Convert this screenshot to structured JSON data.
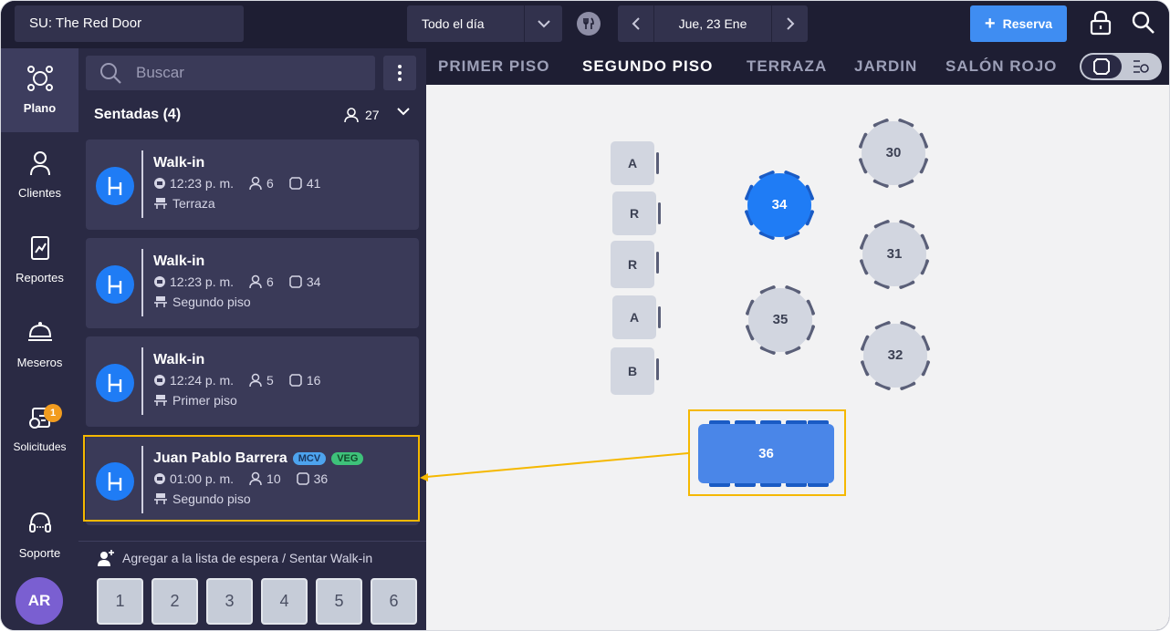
{
  "header": {
    "venue": "SU: The Red Door",
    "shift_label": "Todo el día",
    "date_label": "Jue, 23 Ene",
    "reserve_button": "Reserva"
  },
  "nav": {
    "items": [
      {
        "label": "Plano",
        "icon": "floor-plan-icon",
        "active": true
      },
      {
        "label": "Clientes",
        "icon": "person-icon"
      },
      {
        "label": "Reportes",
        "icon": "report-icon"
      },
      {
        "label": "Meseros",
        "icon": "waiter-icon"
      },
      {
        "label": "Solicitudes",
        "icon": "requests-icon"
      },
      {
        "label": "Soporte",
        "icon": "headset-icon"
      }
    ],
    "requests_badge": "1",
    "avatar_initials": "AR"
  },
  "list": {
    "search_placeholder": "Buscar",
    "section_title": "Sentadas (4)",
    "section_count": "27",
    "cards": [
      {
        "name": "Walk-in",
        "time": "12:23 p. m.",
        "guests": "6",
        "table": "41",
        "zone": "Terraza",
        "tags": []
      },
      {
        "name": "Walk-in",
        "time": "12:23 p. m.",
        "guests": "6",
        "table": "34",
        "zone": "Segundo piso",
        "tags": []
      },
      {
        "name": "Walk-in",
        "time": "12:24 p. m.",
        "guests": "5",
        "table": "16",
        "zone": "Primer piso",
        "tags": []
      },
      {
        "name": "Juan Pablo Barrera",
        "time": "01:00 p. m.",
        "guests": "10",
        "table": "36",
        "zone": "Segundo piso",
        "tags": [
          "MCV",
          "VEG"
        ]
      }
    ],
    "footer_title": "Agregar a la lista de espera / Sentar Walk-in",
    "party_sizes": [
      "1",
      "2",
      "3",
      "4",
      "5",
      "6"
    ]
  },
  "floor": {
    "tabs": [
      "PRIMER PISO",
      "SEGUNDO PISO",
      "TERRAZA",
      "JARDIN",
      "SALÓN ROJO"
    ],
    "active_tab": "SEGUNDO PISO",
    "square_tables": [
      "A",
      "R",
      "R",
      "A",
      "B"
    ],
    "round_tables": [
      "30",
      "34",
      "31",
      "35",
      "32"
    ],
    "selected_table": "34",
    "rect_table": "36",
    "colors": {
      "selected": "#1f7cf5",
      "occupied": "#4a86e8",
      "free": "#d2d6e0",
      "highlight": "#f5b800"
    }
  }
}
